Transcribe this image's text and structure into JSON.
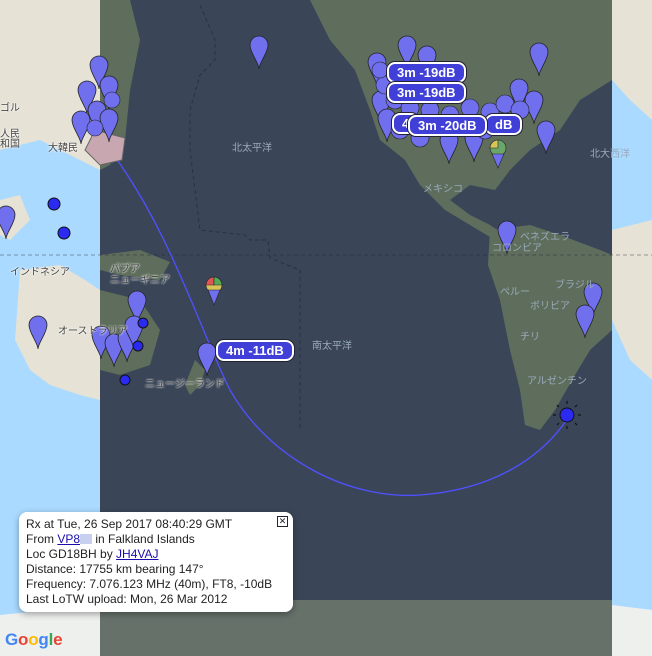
{
  "map": {
    "ocean_color": "#3a4658",
    "day_ocean_color": "#aadaff",
    "land_color": "#5f6e5c",
    "day_land_color": "#e6e2d6",
    "pin_color": "#7070ee",
    "path_color": "#5050ff",
    "labels": {
      "mongolia": "ゴル",
      "china": "人民\n和国",
      "korea": "大韓民",
      "indonesia": "インドネシア",
      "papua": "パプア\nニューギニア",
      "australia": "オーストラリア",
      "new_zealand": "ニュージーランド",
      "north_pacific": "北太平洋",
      "south_pacific": "南太平洋",
      "north_atlantic": "北大西洋",
      "mexico": "メキシコ",
      "venezuela": "ベネズエラ",
      "colombia": "コロンビア",
      "brazil": "ブラジル",
      "peru": "ペルー",
      "bolivia": "ボリビア",
      "chile": "チリ",
      "argentina": "アルゼンチン"
    }
  },
  "signal_reports": [
    {
      "text": "3m -19dB"
    },
    {
      "text": "3m -19dB"
    },
    {
      "text": "4"
    },
    {
      "text": "3m -20dB"
    },
    {
      "text": "dB"
    },
    {
      "text": "4m -11dB"
    }
  ],
  "info_window": {
    "line1": "Rx at Tue, 26 Sep 2017 08:40:29 GMT",
    "from_prefix": "From ",
    "from_call": "VP8",
    "from_suffix": " in Falkland Islands",
    "loc_prefix": "Loc GD18BH by ",
    "loc_call": "JH4VAJ",
    "distance": "Distance: 17755 km bearing 147°",
    "frequency": "Frequency: 7.076.123 MHz (40m), FT8, -10dB",
    "lotw": "Last LoTW upload: Mon, 26 Mar 2012",
    "close_icon": "close-icon"
  },
  "attribution": {
    "logo_letters": [
      "G",
      "o",
      "o",
      "g",
      "l",
      "e"
    ],
    "logo_colors": [
      "#4285f4",
      "#ea4335",
      "#fbbc05",
      "#4285f4",
      "#34a853",
      "#ea4335"
    ]
  }
}
